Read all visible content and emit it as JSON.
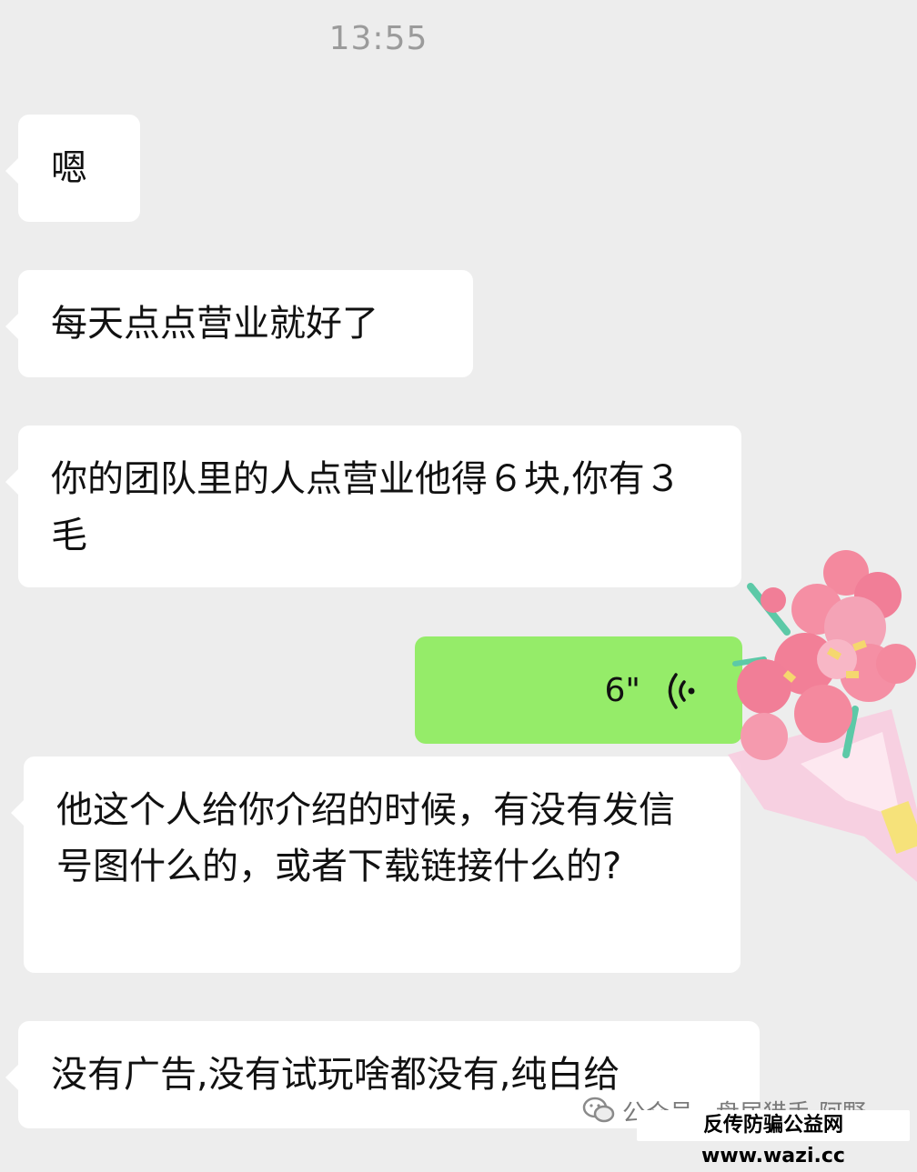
{
  "chat": {
    "timestamp": "13:55",
    "messages": [
      {
        "text": "嗯"
      },
      {
        "text": "每天点点营业就好了"
      },
      {
        "text": "你的团队里的人点营业他得６块,你有３毛"
      },
      {
        "voice_duration": "6\""
      },
      {
        "text": "他这个人给你介绍的时候，有没有发信号图什么的，或者下载链接什么的?"
      },
      {
        "text": "没有广告,没有试玩啥都没有,纯白给"
      }
    ]
  },
  "watermark": {
    "account": "公众号 · 盘居猎手-阿野",
    "site": "反传防骗公益网 www.wazi.cc"
  },
  "colors": {
    "background": "#ededed",
    "bubble_incoming": "#ffffff",
    "bubble_outgoing": "#95ec69"
  },
  "icons": [
    "voice-wave-icon",
    "flower-bouquet-sticker",
    "wechat-icon"
  ]
}
